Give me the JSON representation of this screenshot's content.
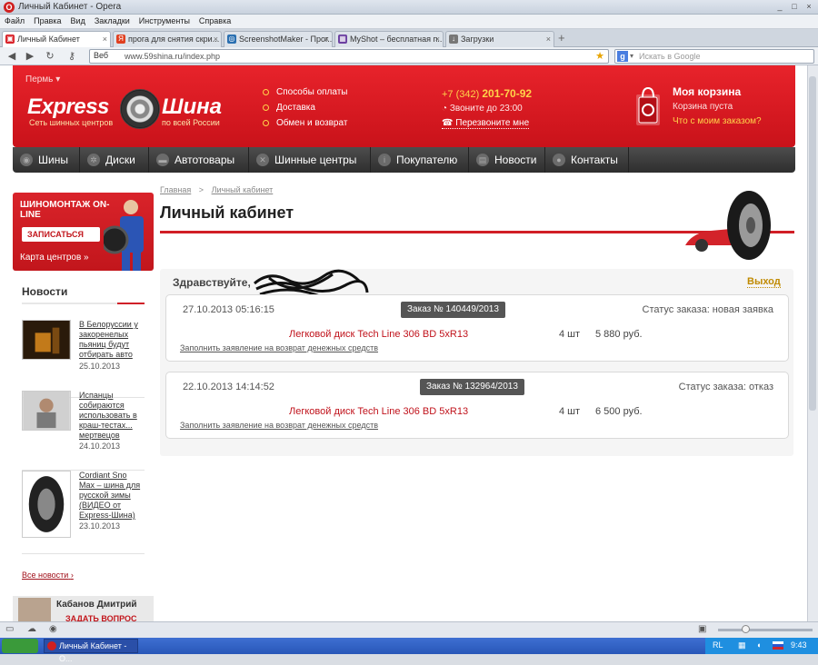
{
  "window": {
    "title": "Личный Кабинет - Opera",
    "minimize": "_",
    "maximize": "□",
    "close": "×"
  },
  "menu": [
    "Файл",
    "Правка",
    "Вид",
    "Закладки",
    "Инструменты",
    "Справка"
  ],
  "tabs": [
    {
      "label": "Личный Кабинет",
      "active": true,
      "icon_color": "#d9232a"
    },
    {
      "label": "прога для снятия скри...",
      "active": false,
      "icon_color": "#e04020"
    },
    {
      "label": "ScreenshotMaker - Прог...",
      "active": false,
      "icon_color": "#2a6fb0"
    },
    {
      "label": "MyShot – бесплатная п...",
      "active": false,
      "icon_color": "#6b3fa0"
    },
    {
      "label": "Загрузки",
      "active": false,
      "icon_color": "#777777"
    }
  ],
  "address": {
    "web_label": "Веб",
    "url": "www.59shina.ru/index.php",
    "search_placeholder": "Искать в Google"
  },
  "site": {
    "city": "Пермь",
    "logo_left": "Express",
    "logo_right": "Шина",
    "tagline_left": "Сеть шинных центров",
    "tagline_right": "по всей России",
    "links": [
      "Способы оплаты",
      "Доставка",
      "Обмен и возврат"
    ],
    "phone_prefix": "+7 (342)",
    "phone_number": "201-70-92",
    "call_hours": "Звоните до 23:00",
    "callback": "Перезвоните мне",
    "cart_title": "Моя корзина",
    "cart_status": "Корзина пуста",
    "cart_question": "Что с моим заказом?"
  },
  "nav": [
    {
      "label": "Шины",
      "icon": "tire-icon"
    },
    {
      "label": "Диски",
      "icon": "rim-icon"
    },
    {
      "label": "Автотовары",
      "icon": "car-goods-icon"
    },
    {
      "label": "Шинные центры",
      "icon": "tools-icon"
    },
    {
      "label": "Покупателю",
      "icon": "info-icon"
    },
    {
      "label": "Новости",
      "icon": "calendar-icon"
    },
    {
      "label": "Контакты",
      "icon": "location-icon"
    }
  ],
  "promo": {
    "title": "ШИНОМОНТАЖ ON-LINE",
    "button": "ЗАПИСАТЬСЯ",
    "map_link": "Карта центров »"
  },
  "news": {
    "title": "Новости",
    "items": [
      {
        "text": "В Белоруссии у закоренелых пьяниц будут отбирать авто",
        "date": "25.10.2013"
      },
      {
        "text": "Испанцы собираются использовать в краш-тестах... мертвецов",
        "date": "24.10.2013"
      },
      {
        "text": "Cordiant Sno Max – шина для русской зимы (ВИДЕО от Express-Шина)",
        "date": "23.10.2013"
      }
    ],
    "all_link": "Все новости"
  },
  "author": {
    "name": "Кабанов Дмитрий",
    "ask": "ЗАДАТЬ ВОПРОС"
  },
  "breadcrumb": {
    "home": "Главная",
    "separator": ">",
    "current": "Личный кабинет"
  },
  "page_title": "Личный кабинет",
  "account": {
    "greeting": "Здравствуйте,",
    "logout": "Выход"
  },
  "orders": [
    {
      "datetime": "27.10.2013 05:16:15",
      "number": "Заказ № 140449/2013",
      "status": "Статус заказа: новая заявка",
      "product": "Легковой диск Tech Line 306 BD 5xR13",
      "qty": "4 шт",
      "price": "5 880 руб.",
      "refund": "Заполнить заявление на возврат денежных средств"
    },
    {
      "datetime": "22.10.2013 14:14:52",
      "number": "Заказ № 132964/2013",
      "status": "Статус заказа: отказ",
      "product": "Легковой диск Tech Line 306 BD 5xR13",
      "qty": "4 шт",
      "price": "6 500 руб.",
      "refund": "Заполнить заявление на возврат денежных средств"
    }
  ],
  "taskbar": {
    "window": "Личный Кабинет - О...",
    "lang": "RL",
    "clock": "9:43"
  }
}
